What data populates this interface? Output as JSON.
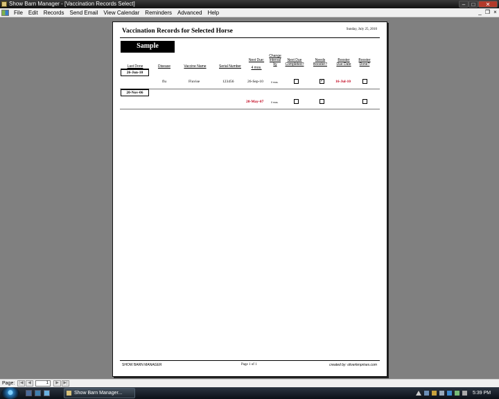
{
  "window": {
    "title": "Show Barn Manager - [Vaccination Records Select]",
    "min_glyph": "–",
    "max_glyph": "□",
    "close_glyph": "✕"
  },
  "menu": [
    "File",
    "Edit",
    "Records",
    "Send Email",
    "View Calendar",
    "Reminders",
    "Advanced",
    "Help"
  ],
  "mdi_controls": {
    "min": "_",
    "restore": "❐",
    "close": "×"
  },
  "report": {
    "title": "Vaccination Records for Selected Horse",
    "date": "Sunday, July 25, 2010",
    "horse": "Sample",
    "columns": {
      "last_done": "Last Done",
      "disease": "Disease",
      "vaccine": "Vaccine Name",
      "serial": "Serial Number",
      "next_due": "Next Due:",
      "interval": "4 mos.",
      "change_interval": [
        "Change",
        "interval",
        "by"
      ],
      "next_completed": [
        "Next Due",
        "Completed?"
      ],
      "needs_booster": [
        "Needs",
        "Booster?"
      ],
      "booster_due": [
        "Booster",
        "Due Date"
      ],
      "booster_done": [
        "Booster",
        "Done?"
      ]
    },
    "records": [
      {
        "date": "26-Jun-10",
        "disease": "flu",
        "vaccine": "Fluvise",
        "serial": "123456",
        "next_due": "26-Sep-10",
        "change": "0 mos.",
        "next_completed": false,
        "needs_booster": true,
        "booster_due": "16-Jul-10",
        "booster_done": false
      },
      {
        "date": "20-Nov-06",
        "disease": "",
        "vaccine": "",
        "serial": "",
        "next_due": "20-May-07",
        "change": "0 mos.",
        "next_completed": false,
        "needs_booster": false,
        "booster_due": "",
        "booster_done": false
      }
    ],
    "footer": {
      "left": "SHOW BARN MANAGER",
      "middle": "Page 1 of 1",
      "right": "created by: oliverlenprises.com"
    }
  },
  "nav": {
    "label": "Page:",
    "current_page": "1",
    "first": "|◀",
    "prev": "◀",
    "next": "▶",
    "last": "▶|"
  },
  "taskbar": {
    "task": "Show Barn Manager...",
    "clock": "5:39 PM"
  },
  "colors": {
    "red": "#c0001a",
    "desktop": "#808080"
  }
}
